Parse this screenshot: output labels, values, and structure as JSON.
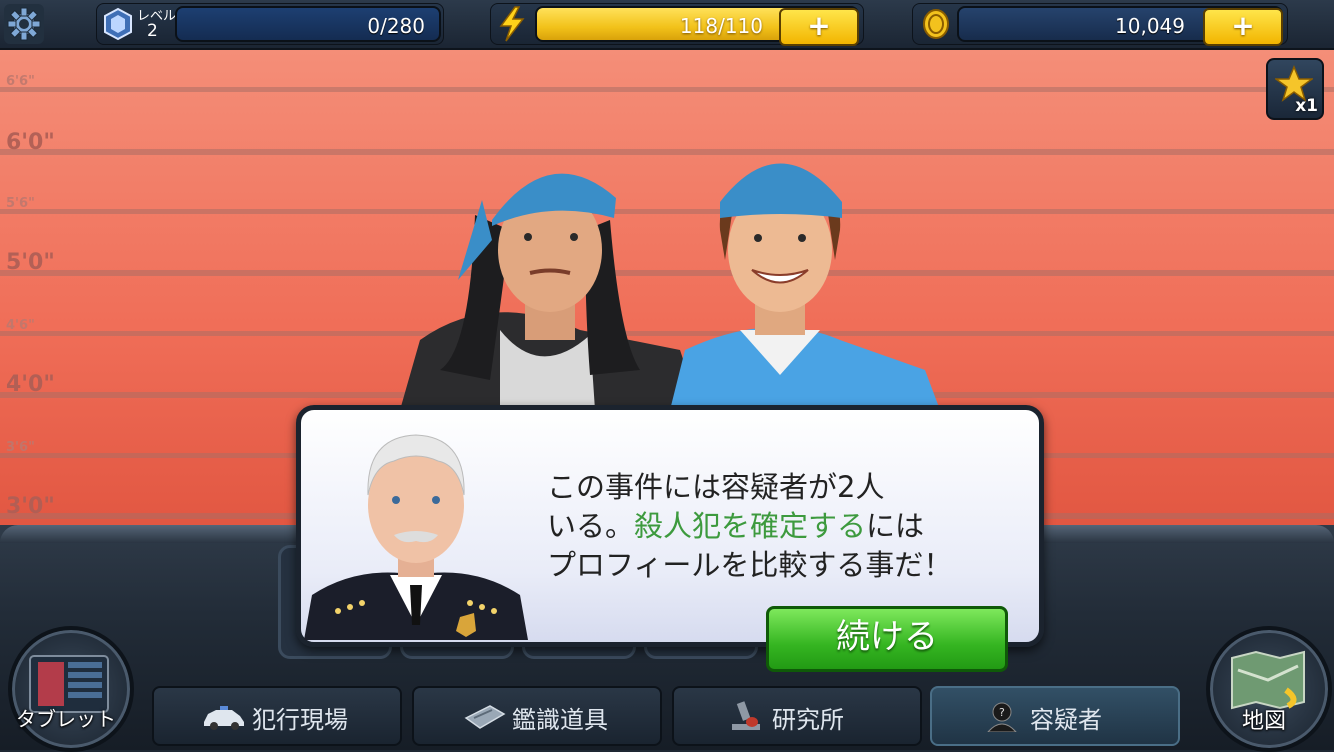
{
  "hud": {
    "level_label": "レベル",
    "level_value": "2",
    "xp_text": "0/280",
    "xp_progress": 0,
    "energy_text": "118/110",
    "energy_progress": 1.0,
    "coins_text": "10,049",
    "plus": "+"
  },
  "height_labels": [
    "6'6\"",
    "6'0\"",
    "5'6\"",
    "5'0\"",
    "4'6\"",
    "4'0\"",
    "3'6\"",
    "3'0\""
  ],
  "star_button": {
    "count": "x1"
  },
  "dialog": {
    "line1": "この事件には容疑者が2人",
    "line2_prefix": "いる。",
    "line2_highlight": "殺人犯を確定する",
    "line2_suffix": "には",
    "line3": "プロフィールを比較する事だ！",
    "continue_label": "続ける"
  },
  "nav": {
    "tablet_label": "タブレット",
    "map_label": "地図",
    "tabs": [
      {
        "label": "犯行現場",
        "icon": "police-car-icon"
      },
      {
        "label": "鑑識道具",
        "icon": "forensics-kit-icon"
      },
      {
        "label": "研究所",
        "icon": "microscope-icon"
      },
      {
        "label": "容疑者",
        "icon": "suspect-icon",
        "active": true
      }
    ]
  },
  "colors": {
    "energy_bar": "#f2c21a",
    "plus_button": "#f5c400",
    "continue_button": "#35b521",
    "highlight_text": "#3d9a3e",
    "wall": "#f07e66"
  }
}
